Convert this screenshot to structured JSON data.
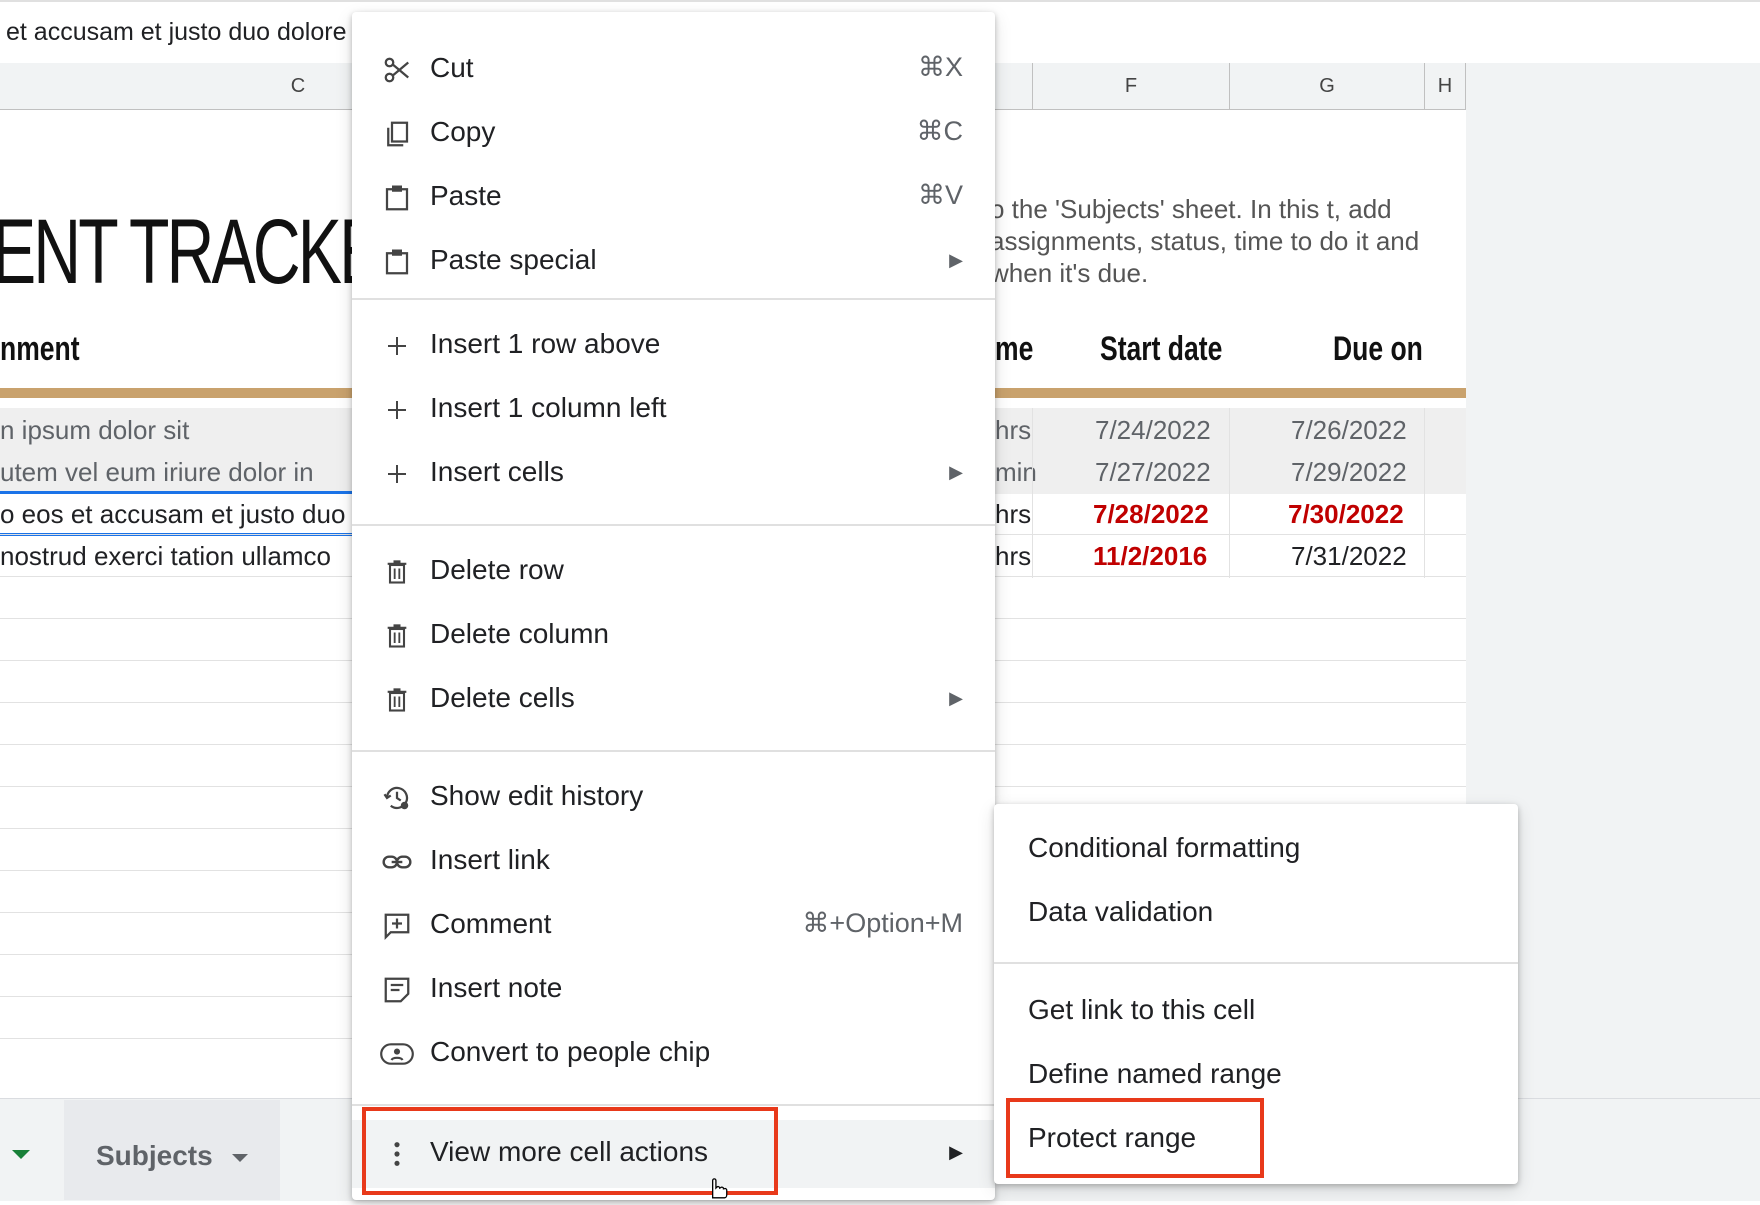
{
  "formula_bar": {
    "text": "et accusam et justo duo dolore"
  },
  "columns": [
    {
      "id": "c",
      "label": "C"
    },
    {
      "id": "f",
      "label": "F"
    },
    {
      "id": "g",
      "label": "G"
    },
    {
      "id": "h",
      "label": "H"
    }
  ],
  "sheet": {
    "title": "ENT TRACKER",
    "assignment_header": "nment",
    "time_header_partial": "me",
    "start_header": "Start date",
    "due_header": "Due on",
    "description": "o the 'Subjects' sheet. In this t, add assignments, status, time to do it and when it's due.",
    "rows": [
      {
        "assignment": "n ipsum dolor sit",
        "time": "hrs",
        "start": "7/24/2022",
        "due": "7/26/2022"
      },
      {
        "assignment": "utem vel eum iriure dolor in",
        "time": "min",
        "start": "7/27/2022",
        "due": "7/29/2022"
      },
      {
        "assignment": "o eos et accusam et justo duo",
        "time": "hrs",
        "start": "7/28/2022",
        "due": "7/30/2022"
      },
      {
        "assignment": "nostrud exerci tation ullamco",
        "time": "hrs",
        "start": "11/2/2016",
        "due": "7/31/2022"
      }
    ]
  },
  "tabs": {
    "subjects": "Subjects"
  },
  "context_menu": {
    "items": [
      {
        "label": "Cut",
        "shortcut": "⌘X",
        "icon": "scissors-icon"
      },
      {
        "label": "Copy",
        "shortcut": "⌘C",
        "icon": "copy-icon"
      },
      {
        "label": "Paste",
        "shortcut": "⌘V",
        "icon": "clipboard-icon"
      },
      {
        "label": "Paste special",
        "icon": "clipboard-icon"
      },
      {
        "label": "Insert 1 row above",
        "icon": "plus-icon"
      },
      {
        "label": "Insert 1 column left",
        "icon": "plus-icon"
      },
      {
        "label": "Insert cells",
        "icon": "plus-icon"
      },
      {
        "label": "Delete row",
        "icon": "trash-icon"
      },
      {
        "label": "Delete column",
        "icon": "trash-icon"
      },
      {
        "label": "Delete cells",
        "icon": "trash-icon"
      },
      {
        "label": "Show edit history",
        "icon": "history-icon"
      },
      {
        "label": "Insert link",
        "icon": "link-icon"
      },
      {
        "label": "Comment",
        "shortcut": "⌘+Option+M",
        "icon": "comment-add-icon"
      },
      {
        "label": "Insert note",
        "icon": "note-icon"
      },
      {
        "label": "Convert to people chip",
        "icon": "people-chip-icon"
      },
      {
        "label": "View more cell actions",
        "icon": "more-vert-icon"
      }
    ]
  },
  "sub_menu": {
    "items": [
      {
        "label": "Conditional formatting"
      },
      {
        "label": "Data validation"
      },
      {
        "label": "Get link to this cell"
      },
      {
        "label": "Define named range"
      },
      {
        "label": "Protect range"
      }
    ]
  },
  "colors": {
    "highlight": "#e8391a",
    "accent_tan": "#c9a26d",
    "date_red": "#c00000"
  }
}
